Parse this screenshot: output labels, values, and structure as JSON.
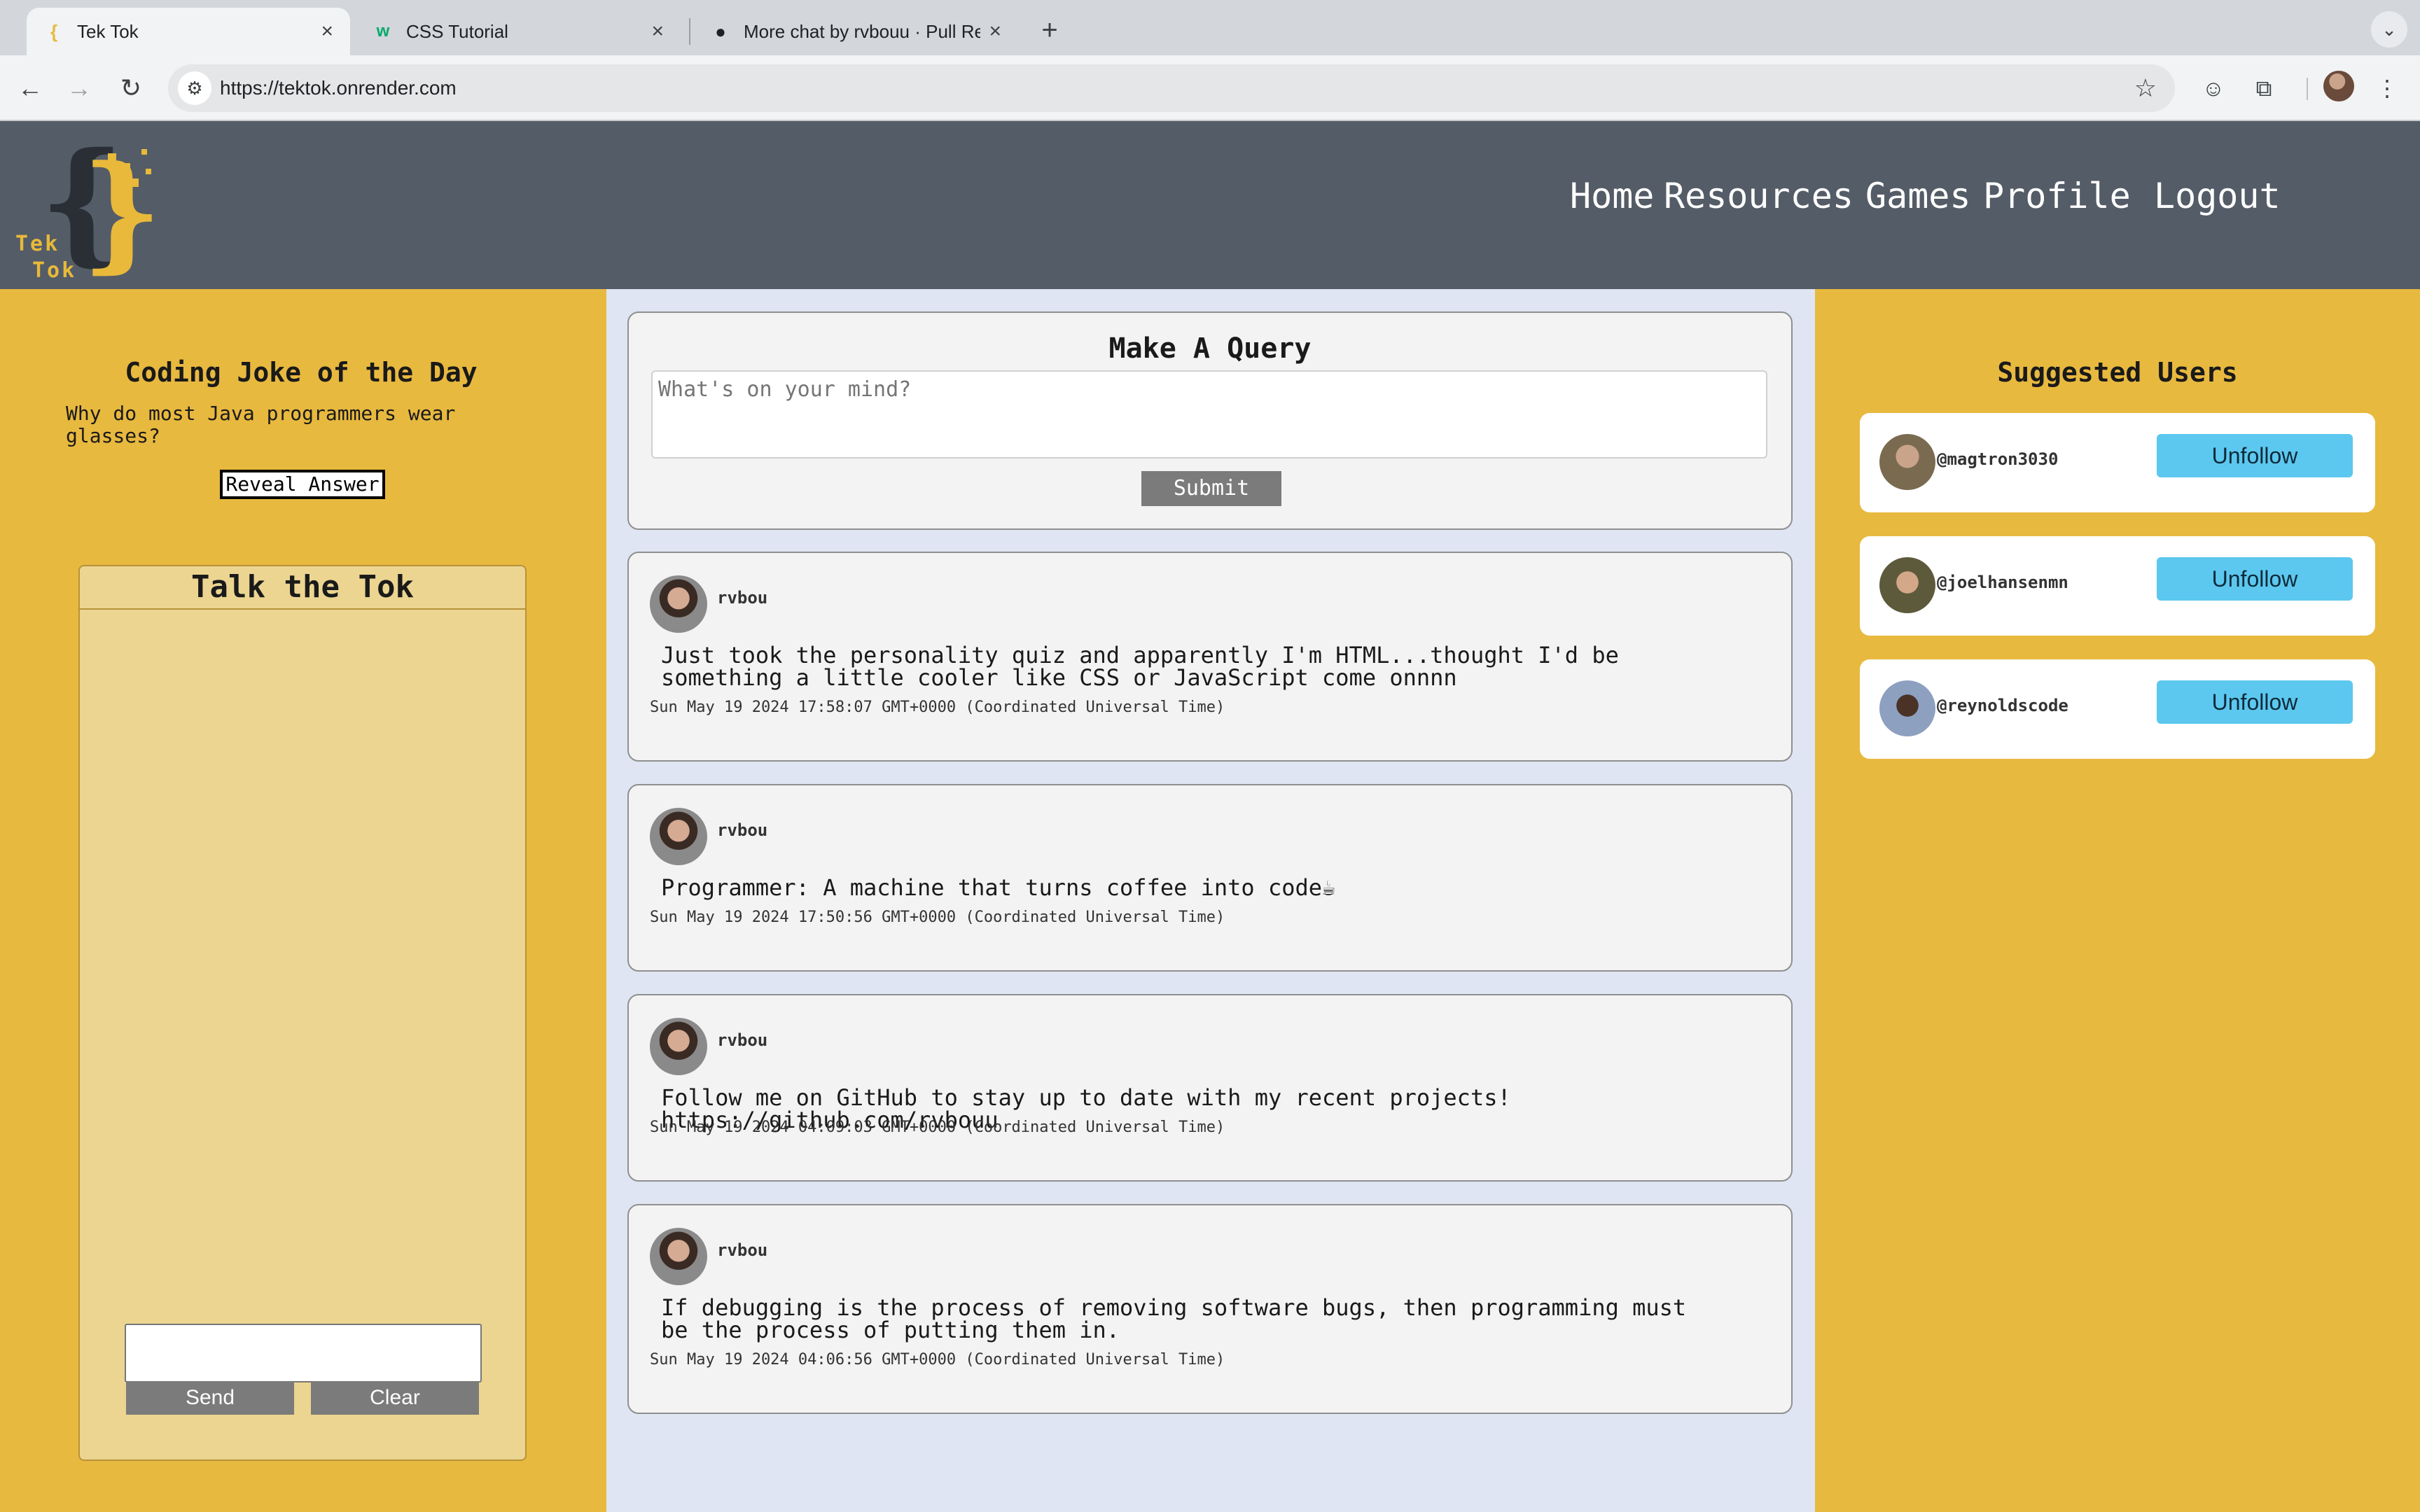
{
  "browser": {
    "tabs": [
      {
        "title": "Tek Tok",
        "icon": "curly-brace-favicon",
        "active": true
      },
      {
        "title": "CSS Tutorial",
        "icon": "w3schools-favicon",
        "active": false
      },
      {
        "title": "More chat by rvbouu · Pull Re",
        "icon": "github-favicon",
        "active": false
      }
    ],
    "url": "https://tektok.onrender.com"
  },
  "header": {
    "logo_line1": "Tek",
    "logo_line2": "Tok",
    "nav": [
      "Home",
      "Resources",
      "Games",
      "Profile",
      "Logout"
    ]
  },
  "joke": {
    "title": "Coding Joke of the Day",
    "question": "Why do most Java programmers wear glasses?",
    "reveal_label": "Reveal Answer"
  },
  "chat": {
    "title": "Talk the Tok",
    "input_value": "",
    "send_label": "Send",
    "clear_label": "Clear"
  },
  "query": {
    "title": "Make A Query",
    "placeholder": "What's on your mind?",
    "submit_label": "Submit"
  },
  "posts": [
    {
      "user": "rvbou",
      "text": "Just took the personality quiz and apparently I'm HTML...thought I'd be something a little cooler like CSS or JavaScript come onnnn",
      "date": "Sun May 19 2024 17:58:07 GMT+0000 (Coordinated Universal Time)"
    },
    {
      "user": "rvbou",
      "text": "Programmer: A machine that turns coffee into code☕",
      "date": "Sun May 19 2024 17:50:56 GMT+0000 (Coordinated Universal Time)"
    },
    {
      "user": "rvbou",
      "text": "Follow me on GitHub to stay up to date with my recent projects! ",
      "link": "https://github.com/rvbouu",
      "date": "Sun May 19 2024 04:09:03 GMT+0000 (Coordinated Universal Time)"
    },
    {
      "user": "rvbou",
      "text": "If debugging is the process of removing software bugs, then programming must be the process of putting them in.",
      "date": "Sun May 19 2024 04:06:56 GMT+0000 (Coordinated Universal Time)"
    }
  ],
  "suggested": {
    "title": "Suggested Users",
    "users": [
      {
        "handle": "@magtron3030",
        "button": "Unfollow"
      },
      {
        "handle": "@joelhansenmn",
        "button": "Unfollow"
      },
      {
        "handle": "@reynoldscode",
        "button": "Unfollow"
      }
    ]
  },
  "colors": {
    "header_bg": "#545c67",
    "side_bg": "#e8b93f",
    "feed_bg": "#dfe5f2",
    "unfollow_bg": "#5cc8ef"
  }
}
